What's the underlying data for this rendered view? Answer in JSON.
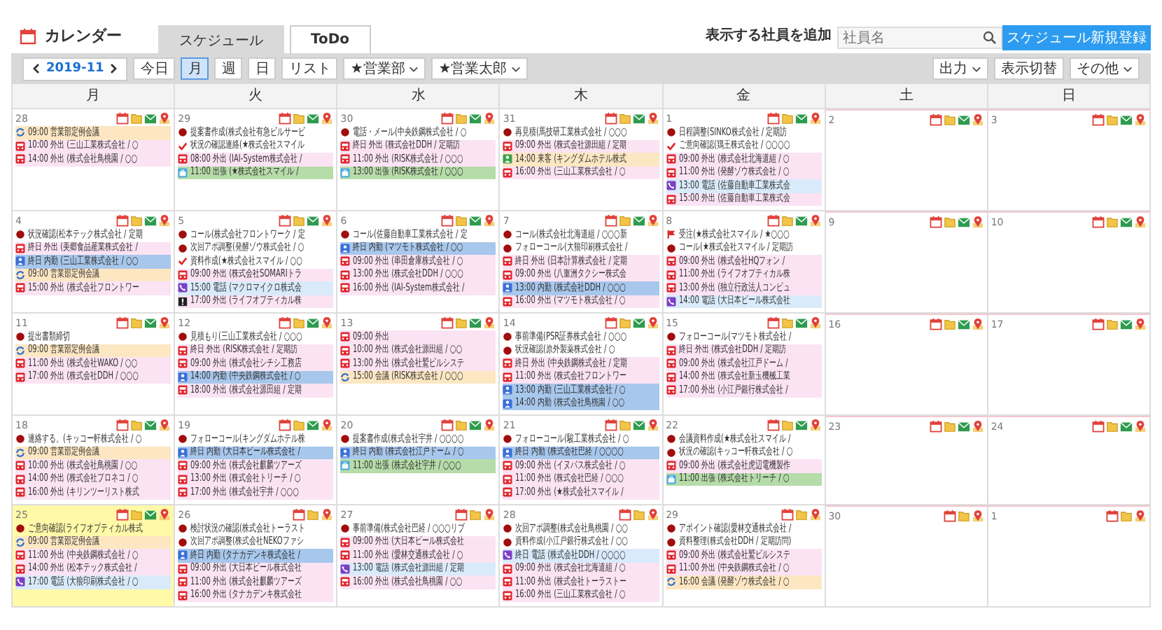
{
  "header": {
    "title": "カレンダー",
    "tabs": [
      {
        "label": "スケジュール",
        "selected": true
      },
      {
        "label": "ToDo",
        "selected": false
      }
    ],
    "add_employee_label": "表示する社員を追加",
    "employee_search": {
      "placeholder": "社員名"
    },
    "new_button": "スケジュール新規登録"
  },
  "toolbar": {
    "month": "2019-11",
    "today_button": "今日",
    "views": [
      {
        "label": "月",
        "selected": true
      },
      {
        "label": "週",
        "selected": false
      },
      {
        "label": "日",
        "selected": false
      },
      {
        "label": "リスト",
        "selected": false
      }
    ],
    "filters": [
      "★営業部",
      "★営業太郎"
    ],
    "right_buttons": [
      {
        "label": "出力",
        "dropdown": true
      },
      {
        "label": "表示切替",
        "dropdown": false
      },
      {
        "label": "その他",
        "dropdown": true
      }
    ]
  },
  "calendar": {
    "weekdays": [
      "月",
      "火",
      "水",
      "木",
      "金",
      "土",
      "日"
    ],
    "weeks": [
      {
        "days": [
          {
            "day": "28",
            "today": false,
            "mail": true,
            "events": [
              {
                "kind": "meeting",
                "text": "09:00 営業部定例会議"
              },
              {
                "kind": "out",
                "text": "10:00 外出 (三山工業株式会社 / ○"
              },
              {
                "kind": "out",
                "text": "14:00 外出 (株式会社鳥桃園 / ○○"
              }
            ]
          },
          {
            "day": "29",
            "today": false,
            "mail": true,
            "events": [
              {
                "kind": "task",
                "text": "提案書作成(株式会社有急ビルサービ"
              },
              {
                "kind": "check",
                "text": "状況の確認連絡(★株式会社スマイル"
              },
              {
                "kind": "out",
                "text": "08:00 外出 (IAI-System株式会社 /"
              },
              {
                "kind": "trip",
                "text": "11:00 出張 (★株式会社スマイル /"
              }
            ]
          },
          {
            "day": "30",
            "today": false,
            "mail": true,
            "events": [
              {
                "kind": "task",
                "text": "電話・メール(中央鉄鋼株式会社 / ○"
              },
              {
                "kind": "out",
                "text": "終日 外出 (株式会社DDH / 定期訪"
              },
              {
                "kind": "out",
                "text": "11:00 外出 (RISK株式会社 / ○○○"
              },
              {
                "kind": "trip",
                "text": "13:00 出張 (RISK株式会社 / ○○○"
              }
            ]
          },
          {
            "day": "31",
            "today": false,
            "mail": true,
            "events": [
              {
                "kind": "task",
                "text": "再見積(馬技研工業株式会社 / ○○○"
              },
              {
                "kind": "out",
                "text": "09:00 外出 (株式会社源田組 / 定期"
              },
              {
                "kind": "visit",
                "text": "14:00 来客 (キングダムホテル株式"
              },
              {
                "kind": "out",
                "text": "16:00 外出 (三山工業株式会社 / ○"
              }
            ]
          },
          {
            "day": "1",
            "today": false,
            "mail": true,
            "events": [
              {
                "kind": "task",
                "text": "日程調整(SINKO株式会社 / 定期訪"
              },
              {
                "kind": "check",
                "text": "ご意向確認(鶏王株式会社 / ○○○○"
              },
              {
                "kind": "out",
                "text": "09:00 外出 (株式会社北海道組 / ○"
              },
              {
                "kind": "out",
                "text": "11:00 外出 (発酵ゾウ株式会社 / ○"
              },
              {
                "kind": "call",
                "text": "13:00 電話 (佐藤自動車工業株式会"
              },
              {
                "kind": "out",
                "text": "15:00 外出 (佐藤自動車工業株式会"
              }
            ]
          },
          {
            "day": "2",
            "today": false,
            "mail": true
          },
          {
            "day": "3",
            "today": false,
            "mail": true
          }
        ]
      },
      {
        "days": [
          {
            "day": "4",
            "today": false,
            "mail": true,
            "events": [
              {
                "kind": "task",
                "text": "状況確認(松本テック株式会社 / 定期"
              },
              {
                "kind": "out",
                "text": "終日 外出 (美郷食品産業株式会社 /"
              },
              {
                "kind": "internal",
                "text": "終日 内勤 (三山工業株式会社 / ○○"
              },
              {
                "kind": "meeting",
                "text": "09:00 営業部定例会議"
              },
              {
                "kind": "out",
                "text": "15:00 外出 (株式会社フロントワー"
              }
            ]
          },
          {
            "day": "5",
            "today": false,
            "mail": true,
            "events": [
              {
                "kind": "task",
                "text": "コール(株式会社フロントワーク / 定"
              },
              {
                "kind": "task",
                "text": "次回アポ調整(発酵ゾウ株式会社 / ○"
              },
              {
                "kind": "check",
                "text": "資料作成(★株式会社スマイル / ○○"
              },
              {
                "kind": "out",
                "text": "09:00 外出 (株式会社SOMARIトラ"
              },
              {
                "kind": "call",
                "text": "15:00 電話 (マクロマイクロ株式会"
              },
              {
                "kind": "alert",
                "text": "17:00 外出 (ライフオプティカル株"
              }
            ]
          },
          {
            "day": "6",
            "today": false,
            "mail": true,
            "events": [
              {
                "kind": "task",
                "text": "コール(佐藤自動車工業株式会社 / 定"
              },
              {
                "kind": "internal",
                "text": "終日 内勤 (マツモト株式会社 / ○○"
              },
              {
                "kind": "out",
                "text": "09:00 外出 (串田倉庫株式会社 / ○"
              },
              {
                "kind": "out",
                "text": "13:00 外出 (株式会社DDH / ○○○"
              },
              {
                "kind": "out",
                "text": "16:00 外出 (IAI-System株式会社 /"
              }
            ]
          },
          {
            "day": "7",
            "today": false,
            "mail": true,
            "events": [
              {
                "kind": "task",
                "text": "コール(株式会社北海道組 / ○○○新"
              },
              {
                "kind": "task",
                "text": "フォローコール(大狼印刷株式会社 /"
              },
              {
                "kind": "out",
                "text": "終日 外出 (日本計算株式会社 / 定期"
              },
              {
                "kind": "out",
                "text": "09:00 外出 (八重洲タクシー株式会"
              },
              {
                "kind": "internal",
                "text": "13:00 内勤 (株式会社DDH / ○○○"
              },
              {
                "kind": "out",
                "text": "16:00 外出 (マツモト株式会社 / ○"
              }
            ]
          },
          {
            "day": "8",
            "today": false,
            "mail": true,
            "events": [
              {
                "kind": "flag",
                "text": "受注(★株式会社スマイル / ★○○○"
              },
              {
                "kind": "task",
                "text": "コール(★株式会社スマイル / 定期訪"
              },
              {
                "kind": "out",
                "text": "09:00 外出 (株式会社HQフォン /"
              },
              {
                "kind": "out",
                "text": "11:00 外出 (ライフオプティカル株"
              },
              {
                "kind": "out",
                "text": "13:00 外出 (独立行政法人コンピュ"
              },
              {
                "kind": "call",
                "text": "14:00 電話 (大日本ビール株式会社"
              }
            ]
          },
          {
            "day": "9",
            "today": false,
            "mail": true
          },
          {
            "day": "10",
            "today": false,
            "mail": true
          }
        ]
      },
      {
        "days": [
          {
            "day": "11",
            "today": false,
            "mail": true,
            "events": [
              {
                "kind": "task",
                "text": "提出書類締切"
              },
              {
                "kind": "meeting",
                "text": "09:00 営業部定例会議"
              },
              {
                "kind": "out",
                "text": "11:00 外出 (株式会社WAKO / ○○"
              },
              {
                "kind": "out",
                "text": "17:00 外出 (株式会社DDH / ○○○"
              }
            ]
          },
          {
            "day": "12",
            "today": false,
            "mail": true,
            "events": [
              {
                "kind": "task",
                "text": "見積もり(三山工業株式会社 / ○○○"
              },
              {
                "kind": "out",
                "text": "終日 外出 (RISK株式会社 / 定期訪"
              },
              {
                "kind": "out",
                "text": "09:00 外出 (株式会社シチシ工務店"
              },
              {
                "kind": "internal",
                "text": "14:00 内勤 (中央鉄鋼株式会社 / ○"
              },
              {
                "kind": "out",
                "text": "18:00 外出 (株式会社源田組 / 定期"
              }
            ]
          },
          {
            "day": "13",
            "today": false,
            "mail": true,
            "events": [
              {
                "kind": "out",
                "text": "09:00 外出"
              },
              {
                "kind": "out",
                "text": "10:00 外出 (株式会社源田組 / ○○"
              },
              {
                "kind": "out",
                "text": "13:00 外出 (株式会社鷲ビルシステ"
              },
              {
                "kind": "meeting",
                "text": "15:00 会議 (RISK株式会社 / ○○○"
              }
            ]
          },
          {
            "day": "14",
            "today": false,
            "mail": true,
            "events": [
              {
                "kind": "task",
                "text": "事前準備(PSR証券株式会社 / ○○○"
              },
              {
                "kind": "task",
                "text": "状況確認(原外製薬株式会社 / ○"
              },
              {
                "kind": "out",
                "text": "終日 外出 (中央鉄鋼株式会社 / 定期"
              },
              {
                "kind": "out",
                "text": "11:00 外出 (株式会社フロントワー"
              },
              {
                "kind": "internal",
                "text": "13:00 内勤 (三山工業株式会社 / ○"
              },
              {
                "kind": "internal",
                "text": "14:00 内勤 (株式会社鳥桃園 / ○○"
              }
            ]
          },
          {
            "day": "15",
            "today": false,
            "mail": true,
            "events": [
              {
                "kind": "task",
                "text": "フォローコール(マツモト株式会社 /"
              },
              {
                "kind": "out",
                "text": "終日 外出 (株式会社DDH / 定期訪"
              },
              {
                "kind": "out",
                "text": "09:00 外出 (株式会社江戸ドーム /"
              },
              {
                "kind": "out",
                "text": "14:00 外出 (株式会社新玉機械工業"
              },
              {
                "kind": "out",
                "text": "17:00 外出 (小江戸銀行株式会社 /"
              }
            ]
          },
          {
            "day": "16",
            "today": false,
            "mail": true
          },
          {
            "day": "17",
            "today": false,
            "mail": true
          }
        ]
      },
      {
        "days": [
          {
            "day": "18",
            "today": false,
            "mail": true,
            "events": [
              {
                "kind": "task",
                "text": "連絡する。(キッコー軒株式会社 / ○"
              },
              {
                "kind": "meeting",
                "text": "09:00 営業部定例会議"
              },
              {
                "kind": "out",
                "text": "10:00 外出 (株式会社鳥桃園 / ○○"
              },
              {
                "kind": "out",
                "text": "14:00 外出 (株式会社プロネコ / ○"
              },
              {
                "kind": "out",
                "text": "16:00 外出 (キリンツーリスト株式"
              }
            ]
          },
          {
            "day": "19",
            "today": false,
            "mail": true,
            "events": [
              {
                "kind": "task",
                "text": "フォローコール(キングダムホテル株"
              },
              {
                "kind": "internal",
                "text": "終日 内勤 (大日本ビール株式会社 /"
              },
              {
                "kind": "out",
                "text": "09:00 外出 (株式会社麒麟ツアーズ"
              },
              {
                "kind": "out",
                "text": "13:00 外出 (株式会社トリーチ / ○"
              },
              {
                "kind": "out",
                "text": "17:00 外出 (株式会社宇井 / ○○○"
              }
            ]
          },
          {
            "day": "20",
            "today": false,
            "mail": true,
            "events": [
              {
                "kind": "task",
                "text": "提案書作成(株式会社宇井 / ○○○○"
              },
              {
                "kind": "internal",
                "text": "終日 内勤 (株式会社江戸ドーム / ○"
              },
              {
                "kind": "trip",
                "text": "11:00 出張 (株式会社宇井 / ○○○"
              }
            ]
          },
          {
            "day": "21",
            "today": false,
            "mail": true,
            "events": [
              {
                "kind": "task",
                "text": "フォローコール(駿工業株式会社 / ○"
              },
              {
                "kind": "internal",
                "text": "終日 内勤 (株式会社巴経 / ○○○○"
              },
              {
                "kind": "out",
                "text": "09:00 外出 (イヌパス株式会社 / ○"
              },
              {
                "kind": "out",
                "text": "11:00 外出 (株式会社巴経 / ○○○"
              },
              {
                "kind": "out",
                "text": "17:00 外出 (★株式会社スマイル /"
              }
            ]
          },
          {
            "day": "22",
            "today": false,
            "mail": true,
            "events": [
              {
                "kind": "task",
                "text": "会議資料作成(★株式会社スマイル /"
              },
              {
                "kind": "task",
                "text": "状況の確認(キッコー軒株式会社 / ○"
              },
              {
                "kind": "out",
                "text": "09:00 外出 (株式会社虎辺電機製作"
              },
              {
                "kind": "trip",
                "text": "11:00 出張 (株式会社トリーチ / ○"
              }
            ]
          },
          {
            "day": "23",
            "today": false,
            "mail": true
          },
          {
            "day": "24",
            "today": false,
            "mail": true
          }
        ]
      },
      {
        "days": [
          {
            "day": "25",
            "today": true,
            "mail": true,
            "events": [
              {
                "kind": "task",
                "text": "ご意向確認(ライフオプティカル株式"
              },
              {
                "kind": "meeting",
                "text": "09:00 営業部定例会議"
              },
              {
                "kind": "out",
                "text": "11:00 外出 (中央鉄鋼株式会社 / ○"
              },
              {
                "kind": "out",
                "text": "14:00 外出 (松本テック株式会社 /"
              },
              {
                "kind": "call",
                "text": "17:00 電話 (大狼印刷株式会社 / ○"
              }
            ]
          },
          {
            "day": "26",
            "today": false,
            "mail": false,
            "events": [
              {
                "kind": "task",
                "text": "検討状況の確認(株式会社トーラスト"
              },
              {
                "kind": "task",
                "text": "次回アポ調整(株式会社NEKOファシ"
              },
              {
                "kind": "internal",
                "text": "終日 内勤 (タナカデンキ株式会社 /"
              },
              {
                "kind": "out",
                "text": "09:00 外出 (大日本ビール株式会社"
              },
              {
                "kind": "out",
                "text": "11:00 外出 (株式会社麒麟ツアーズ"
              },
              {
                "kind": "out",
                "text": "16:00 外出 (タナカデンキ株式会社"
              }
            ]
          },
          {
            "day": "27",
            "today": false,
            "mail": false,
            "events": [
              {
                "kind": "task",
                "text": "事前準備(株式会社巴経 / ○○○リブ"
              },
              {
                "kind": "out",
                "text": "09:00 外出 (大日本ビール株式会社"
              },
              {
                "kind": "out",
                "text": "11:00 外出 (愛林交通株式会社 / ○"
              },
              {
                "kind": "call",
                "text": "13:00 電話 (株式会社源田組 / 定期"
              },
              {
                "kind": "out",
                "text": "16:00 外出 (株式会社鳥桃園 / ○○"
              }
            ]
          },
          {
            "day": "28",
            "today": false,
            "mail": false,
            "events": [
              {
                "kind": "task",
                "text": "次回アポ調整(株式会社鳥桃園 / ○○"
              },
              {
                "kind": "task",
                "text": "資料作成(小江戸銀行株式会社 / ○○"
              },
              {
                "kind": "call",
                "text": "終日 電話 (株式会社DDH / ○○○○"
              },
              {
                "kind": "out",
                "text": "09:00 外出 (株式会社北海道組 / ○"
              },
              {
                "kind": "out",
                "text": "11:00 外出 (株式会社トーラストー"
              },
              {
                "kind": "out",
                "text": "16:00 外出 (三山工業株式会社 / ○"
              }
            ]
          },
          {
            "day": "29",
            "today": false,
            "mail": false,
            "events": [
              {
                "kind": "task",
                "text": "アポイント確認(愛林交通株式会社 /"
              },
              {
                "kind": "task",
                "text": "資料整理(株式会社DDH / 定期訪問)"
              },
              {
                "kind": "out",
                "text": "09:00 外出 (株式会社鷲ビルシステ"
              },
              {
                "kind": "out",
                "text": "11:00 外出 (中央鉄鋼株式会社 / ○"
              },
              {
                "kind": "meeting",
                "text": "16:00 会議 (発酵ゾウ株式会社 / ○"
              }
            ]
          },
          {
            "day": "30",
            "today": false,
            "mail": false
          },
          {
            "day": "1",
            "today": false,
            "mail": false
          }
        ]
      }
    ]
  }
}
